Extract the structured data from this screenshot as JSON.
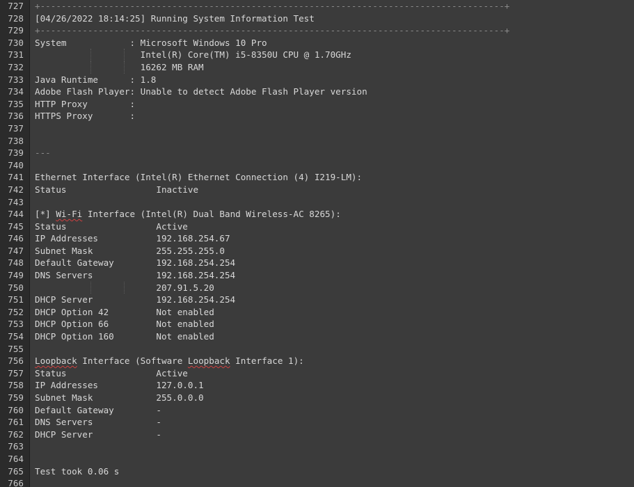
{
  "editor": {
    "lines": [
      {
        "n": "727",
        "text": "+----------------------------------------------------------------------------------------+",
        "dim": true
      },
      {
        "n": "728",
        "text": "[04/26/2022 18:14:25] Running System Information Test"
      },
      {
        "n": "729",
        "text": "+----------------------------------------------------------------------------------------+",
        "dim": true
      },
      {
        "n": "730",
        "text": "System            : Microsoft Windows 10 Pro"
      },
      {
        "n": "731",
        "text": "                    Intel(R) Core(TM) i5-8350U CPU @ 1.70GHz"
      },
      {
        "n": "732",
        "text": "                    16262 MB RAM"
      },
      {
        "n": "733",
        "text": "Java Runtime      : 1.8"
      },
      {
        "n": "734",
        "text": "Adobe Flash Player: Unable to detect Adobe Flash Player version"
      },
      {
        "n": "735",
        "text": "HTTP Proxy        :"
      },
      {
        "n": "736",
        "text": "HTTPS Proxy       :"
      },
      {
        "n": "737",
        "text": ""
      },
      {
        "n": "738",
        "text": ""
      },
      {
        "n": "739",
        "text": "---",
        "dim": true
      },
      {
        "n": "740",
        "text": ""
      },
      {
        "n": "741",
        "text": "Ethernet Interface (Intel(R) Ethernet Connection (4) I219-LM):"
      },
      {
        "n": "742",
        "text": "Status                 Inactive"
      },
      {
        "n": "743",
        "text": ""
      },
      {
        "n": "744",
        "pre": "[*] ",
        "squig": "Wi-Fi",
        "post": " Interface (Intel(R) Dual Band Wireless-AC 8265):"
      },
      {
        "n": "745",
        "text": "Status                 Active"
      },
      {
        "n": "746",
        "text": "IP Addresses           192.168.254.67"
      },
      {
        "n": "747",
        "text": "Subnet Mask            255.255.255.0"
      },
      {
        "n": "748",
        "text": "Default Gateway        192.168.254.254"
      },
      {
        "n": "749",
        "text": "DNS Servers            192.168.254.254"
      },
      {
        "n": "750",
        "text": "                       207.91.5.20"
      },
      {
        "n": "751",
        "text": "DHCP Server            192.168.254.254"
      },
      {
        "n": "752",
        "text": "DHCP Option 42         Not enabled"
      },
      {
        "n": "753",
        "text": "DHCP Option 66         Not enabled"
      },
      {
        "n": "754",
        "text": "DHCP Option 160        Not enabled"
      },
      {
        "n": "755",
        "text": ""
      },
      {
        "n": "756",
        "pre": "",
        "squig": "Loopback",
        "post": " Interface (Software ",
        "squig2": "Loopback",
        "post2": " Interface 1):"
      },
      {
        "n": "757",
        "text": "Status                 Active"
      },
      {
        "n": "758",
        "text": "IP Addresses           127.0.0.1"
      },
      {
        "n": "759",
        "text": "Subnet Mask            255.0.0.0"
      },
      {
        "n": "760",
        "text": "Default Gateway        -"
      },
      {
        "n": "761",
        "text": "DNS Servers            -"
      },
      {
        "n": "762",
        "text": "DHCP Server            -"
      },
      {
        "n": "763",
        "text": ""
      },
      {
        "n": "764",
        "text": ""
      },
      {
        "n": "765",
        "text": "Test took 0.06 s"
      },
      {
        "n": "766",
        "text": ""
      }
    ]
  }
}
